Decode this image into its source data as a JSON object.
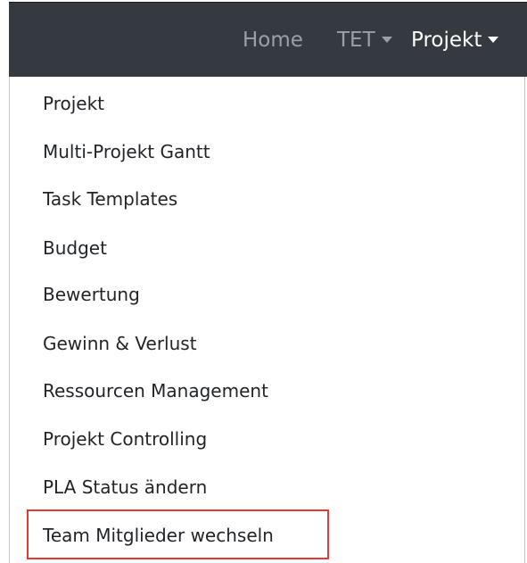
{
  "navbar": {
    "home_label": "Home",
    "tet_label": "TET",
    "projekt_label": "Projekt"
  },
  "dropdown": {
    "items": [
      {
        "label": "Projekt"
      },
      {
        "label": "Multi-Projekt Gantt"
      },
      {
        "label": "Task Templates"
      },
      {
        "label": "Budget"
      },
      {
        "label": "Bewertung"
      },
      {
        "label": "Gewinn & Verlust"
      },
      {
        "label": "Ressourcen Management"
      },
      {
        "label": "Projekt Controlling"
      },
      {
        "label": "PLA Status ändern"
      },
      {
        "label": "Team Mitglieder wechseln"
      }
    ],
    "highlighted_item": "Team Mitglieder wechseln"
  },
  "colors": {
    "navbar_background": "#343a40",
    "nav_inactive": "#9aa0a6",
    "nav_active": "#ffffff",
    "menu_text": "#212529",
    "highlight_border": "#e53935"
  }
}
